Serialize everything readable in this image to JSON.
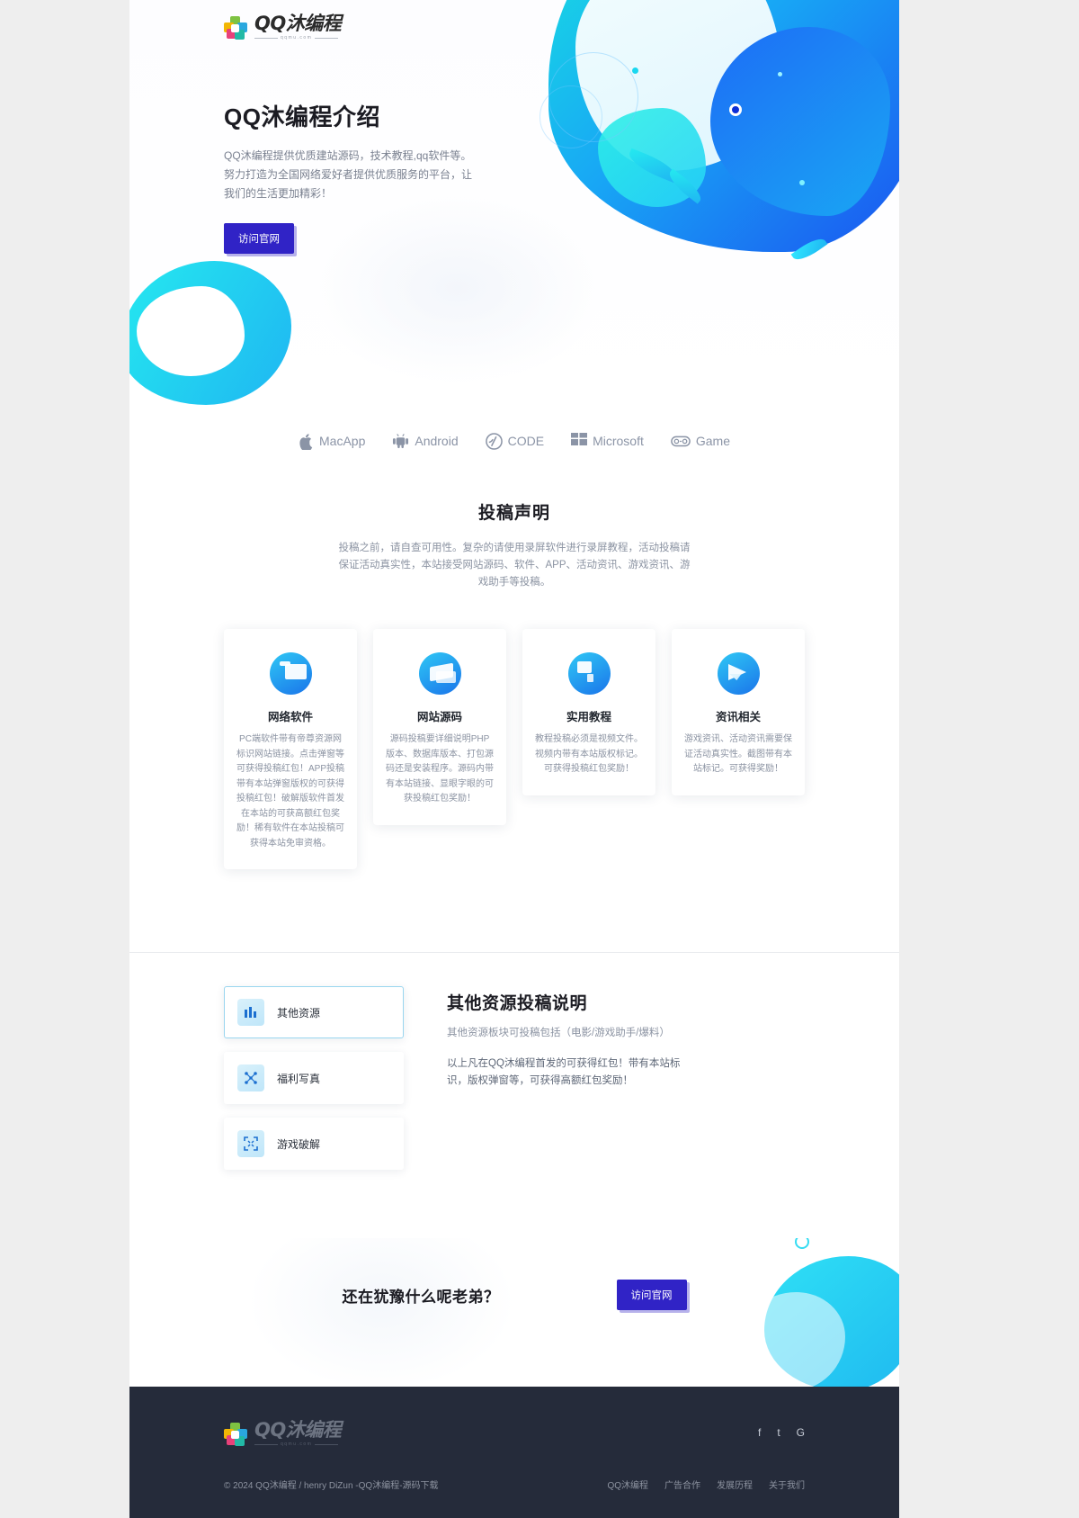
{
  "brand": {
    "logo_name": "QQ沐编程",
    "logo_sub": "qqmu.com",
    "logo_icon": "colored-cube-logo-icon"
  },
  "hero": {
    "title": "QQ沐编程介绍",
    "desc": "QQ沐编程提供优质建站源码，技术教程,qq软件等。努力打造为全国网络爱好者提供优质服务的平台，让我们的生活更加精彩！",
    "cta_label": "访问官网"
  },
  "brandrow": [
    {
      "label": "MacApp",
      "icon": "apple-icon"
    },
    {
      "label": "Android",
      "icon": "android-icon"
    },
    {
      "label": "CODE",
      "icon": "code-slash-icon"
    },
    {
      "label": "Microsoft",
      "icon": "windows-grid-icon"
    },
    {
      "label": "Game",
      "icon": "gamepad-icon"
    }
  ],
  "declare": {
    "title": "投稿声明",
    "paragraph": "投稿之前，请自查可用性。复杂的请使用录屏软件进行录屏教程，活动投稿请保证活动真实性，本站接受网站源码、软件、APP、活动资讯、游戏资讯、游戏助手等投稿。"
  },
  "cards": [
    {
      "title": "网络软件",
      "icon": "folder-disc-icon",
      "desc": "PC端软件带有帝尊资源网标识网站链接。点击弹窗等可获得投稿红包！APP投稿带有本站弹窗版权的可获得投稿红包！破解版软件首发在本站的可获高额红包奖励！稀有软件在本站投稿可获得本站免审资格。"
    },
    {
      "title": "网站源码",
      "icon": "folder-send-icon",
      "desc": "源码投稿要详细说明PHP版本、数据库版本、打包源码还是安装程序。源码内带有本站链接、显眼字眼的可获投稿红包奖励！"
    },
    {
      "title": "实用教程",
      "icon": "moon-book-icon",
      "desc": "教程投稿必须是视频文件。视频内带有本站版权标记。可获得投稿红包奖励！"
    },
    {
      "title": "资讯相关",
      "icon": "paper-plane-icon",
      "desc": "游戏资讯、活动资讯需要保证活动真实性。截图带有本站标记。可获得奖励！"
    }
  ],
  "tabs": [
    {
      "label": "其他资源",
      "icon": "bar-chart-icon",
      "active": true
    },
    {
      "label": "福利写真",
      "icon": "shuffle-dots-icon",
      "active": false
    },
    {
      "label": "游戏破解",
      "icon": "expand-frame-icon",
      "active": false
    }
  ],
  "tabcontent": {
    "title": "其他资源投稿说明",
    "p1": "其他资源板块可投稿包括（电影/游戏助手/爆料）",
    "p2": "以上凡在QQ沐编程首发的可获得红包！带有本站标识，版权弹窗等，可获得高额红包奖励！"
  },
  "cta": {
    "title": "还在犹豫什么呢老弟？",
    "button": "访问官网"
  },
  "footer": {
    "logo_name": "QQ沐编程",
    "logo_sub": "qqmu.com",
    "socials": [
      {
        "label": "f",
        "icon": "facebook-icon"
      },
      {
        "label": "t",
        "icon": "twitter-icon"
      },
      {
        "label": "G",
        "icon": "google-icon"
      }
    ],
    "copyright": "© 2024 QQ沐编程 / henry DiZun -QQ沐编程-源码下载",
    "links": [
      {
        "label": "QQ沐编程"
      },
      {
        "label": "广告合作"
      },
      {
        "label": "发展历程"
      },
      {
        "label": "关于我们"
      }
    ]
  },
  "colors": {
    "accent": "#3023c6",
    "cyan": "#1fb9f0",
    "blue": "#1b4ff0",
    "footer_bg": "#252b3a",
    "page_bg": "#eeeeee"
  }
}
